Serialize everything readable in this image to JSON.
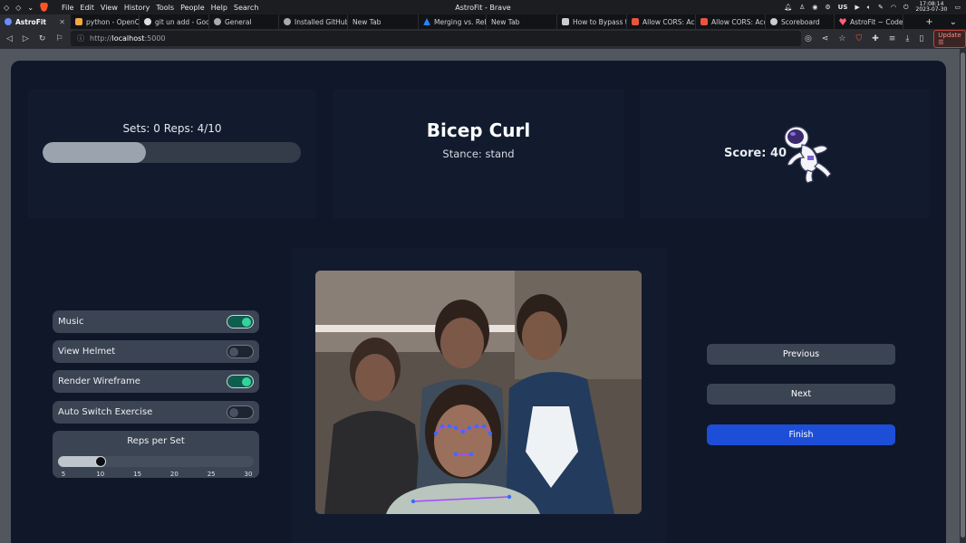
{
  "os": {
    "menu": [
      "File",
      "Edit",
      "View",
      "History",
      "Tools",
      "People",
      "Help",
      "Search"
    ],
    "window_title": "AstroFit - Brave",
    "keyboard": "US",
    "time": "17:08:14",
    "date": "2023-07-30"
  },
  "tabs": [
    {
      "label": "AstroFit",
      "color": "#6b8cff",
      "active": true
    },
    {
      "label": "python - OpenC",
      "color": "#f4a742"
    },
    {
      "label": "git un add - Goo",
      "color": "#dddddd"
    },
    {
      "label": "General",
      "color": "#aaaaaa"
    },
    {
      "label": "Installed GitHub",
      "color": "#aaaaaa"
    },
    {
      "label": "New Tab",
      "color": ""
    },
    {
      "label": "Merging vs. Reb",
      "color": "#2684ff"
    },
    {
      "label": "New Tab",
      "color": ""
    },
    {
      "label": "How to Bypass th",
      "color": "#cccccc"
    },
    {
      "label": "Allow CORS: Acc",
      "color": "#e8553e"
    },
    {
      "label": "Allow CORS: Acc",
      "color": "#e8553e"
    },
    {
      "label": "Scoreboard",
      "color": "#cccccc"
    },
    {
      "label": "AstroFit ~ CodeS",
      "color": "#ff5f7a"
    }
  ],
  "address": {
    "prefix": "http://",
    "host": "localhost",
    "port": ":5000",
    "update_label": "Update"
  },
  "app": {
    "sets_reps": "Sets: 0 Reps: 4/10",
    "progress_fraction": 0.4,
    "exercise": "Bicep Curl",
    "stance": "Stance: stand",
    "score": "Score: 40",
    "toggles": [
      {
        "label": "Music",
        "on": true
      },
      {
        "label": "View Helmet",
        "on": false
      },
      {
        "label": "Render Wireframe",
        "on": true
      },
      {
        "label": "Auto Switch Exercise",
        "on": false
      }
    ],
    "reps_per_set": {
      "title": "Reps per Set",
      "value": 10,
      "min": 5,
      "max": 30,
      "ticks": [
        "5",
        "10",
        "15",
        "20",
        "25",
        "30"
      ]
    },
    "buttons": {
      "previous": "Previous",
      "next": "Next",
      "finish": "Finish"
    },
    "colors": {
      "accent": "#1d4ed8",
      "toggle_on": "#34d399"
    }
  }
}
